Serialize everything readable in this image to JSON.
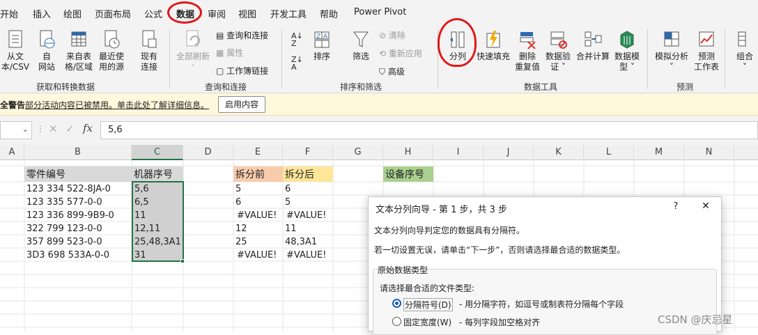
{
  "menu": {
    "tabs": [
      "开始",
      "插入",
      "绘图",
      "页面布局",
      "公式",
      "数据",
      "审阅",
      "视图",
      "开发工具",
      "帮助",
      "Power Pivot"
    ],
    "active": "数据"
  },
  "ribbon": {
    "get_data": {
      "from_text_csv": "从文\n本/CSV",
      "from_web": "自\n网站",
      "from_table": "来自表\n格/区域",
      "recent_sources": "最近使\n用的源",
      "existing_connections": "现有\n连接",
      "group_label": "获取和转换数据"
    },
    "queries": {
      "refresh_all": "全部刷新",
      "queries_connections": "查询和连接",
      "properties": "属性",
      "workbook_links": "工作簿链接",
      "group_label": "查询和连接"
    },
    "sort_filter": {
      "sort": "排序",
      "filter": "筛选",
      "clear": "清除",
      "reapply": "重新应用",
      "advanced": "高级",
      "group_label": "排序和筛选"
    },
    "data_tools": {
      "text_to_columns": "分列",
      "flash_fill": "快速填充",
      "remove_duplicates": "删除\n重复值",
      "data_validation": "数据验\n证 ˅",
      "consolidate": "合并计算",
      "data_model": "数据模\n型 ˅",
      "group_label": "数据工具"
    },
    "forecast": {
      "what_if": "模拟分析\n˅",
      "forecast_sheet": "预测\n工作表",
      "group_label": "预测"
    },
    "outline": {
      "group": "组合\n˅"
    }
  },
  "security_bar": {
    "title": "全警告",
    "message": "部分活动内容已被禁用。单击此处了解详细信息。",
    "button": "启用内容"
  },
  "formula_bar": {
    "formula": "5,6"
  },
  "columns": [
    "A",
    "B",
    "C",
    "D",
    "E",
    "F",
    "G",
    "H",
    "I",
    "J",
    "K",
    "L",
    "M",
    "N"
  ],
  "selected_column": "C",
  "sheet": {
    "headers": {
      "B": "零件编号",
      "C": "机器序号",
      "E": "拆分前",
      "F": "拆分后",
      "H": "设备序号"
    },
    "rows": [
      {
        "B": "123 334 522-8JA-0",
        "C": "5,6",
        "E": "5",
        "F": "6"
      },
      {
        "B": "123 335 577-0-0",
        "C": "6,5",
        "E": "6",
        "F": "5"
      },
      {
        "B": "123 336 899-9B9-0",
        "C": "11",
        "E": "#VALUE!",
        "F": "#VALUE!"
      },
      {
        "B": "322 799 123-0-0",
        "C": "12,11",
        "E": "12",
        "F": "11"
      },
      {
        "B": "357 899 523-0-0",
        "C": "25,48,3A1",
        "E": "25",
        "F": "48,3A1"
      },
      {
        "B": "3D3 698 533A-0-0",
        "C": "31",
        "E": "#VALUE!",
        "F": "#VALUE!"
      }
    ]
  },
  "dialog": {
    "title": "文本分列向导 - 第 1 步，共 3 步",
    "help": "?",
    "close": "✕",
    "line1": "文本分列向导判定您的数据具有分隔符。",
    "line2": "若一切设置无误，请单击“下一步”，否则请选择最合适的数据类型。",
    "section": "原始数据类型",
    "prompt": "请选择最合适的文件类型:",
    "option1_label": "分隔符号(D)",
    "option1_desc": "- 用分隔字符，如逗号或制表符分隔每个字段",
    "option2_label": "固定宽度(W)",
    "option2_desc": "- 每列字段加空格对齐",
    "selected_option": "分隔符号(D)"
  },
  "watermark": "CSDN @庆忌星",
  "colors": {
    "excel_green": "#217346",
    "header_gray": "#d9d9d9",
    "header_orange": "#f8cbad",
    "header_yellow": "#ffe699",
    "header_green": "#a9d08e",
    "annotation_red": "#e01818",
    "security_bg": "#fff8dc"
  }
}
